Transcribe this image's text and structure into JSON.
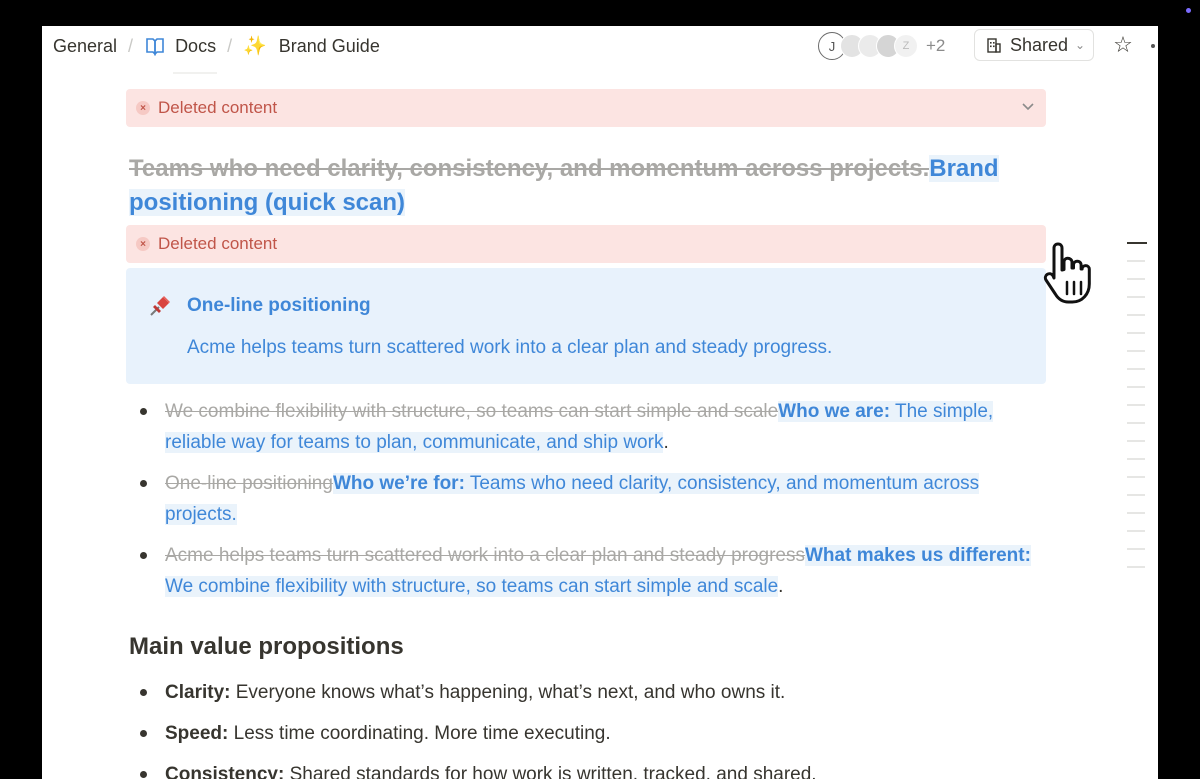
{
  "breadcrumb": {
    "items": [
      "General",
      "Docs",
      "Brand Guide"
    ],
    "separator": "/",
    "icons": [
      "",
      "book-icon",
      "sparkle-icon"
    ]
  },
  "collaborators": {
    "initials": [
      "J",
      "",
      "",
      "",
      "Z"
    ],
    "more_count": "+2"
  },
  "share_button": {
    "label": "Shared"
  },
  "deleted_banners": [
    {
      "label": "Deleted content"
    },
    {
      "label": "Deleted content"
    }
  ],
  "heading": {
    "deleted_text": "Teams who need clarity, consistency, and momentum across projects.",
    "added_text": "Brand positioning (quick scan)"
  },
  "callout": {
    "icon": "pushpin",
    "title": "One-line positioning",
    "body": "Acme helps teams turn scattered work into a clear plan and steady progress."
  },
  "positioning_list": [
    {
      "deleted": "We combine flexibility with structure, so teams can start simple and scale",
      "added_bold": "Who we are:",
      "added_text": " The simple, reliable way for teams to plan, communicate, and ship work",
      "tail": "."
    },
    {
      "deleted": "One-line positioning",
      "added_bold": "Who we’re for:",
      "added_text": " Teams who need clarity, consistency, and momentum across projects.",
      "tail": ""
    },
    {
      "deleted": "Acme helps teams turn scattered work into a clear plan and steady progress",
      "added_bold": "What makes us different:",
      "added_text": " We combine flexibility with structure, so teams can start simple and scale",
      "tail": "."
    }
  ],
  "section_heading": "Main value propositions",
  "value_props": [
    {
      "term": "Clarity:",
      "text": " Everyone knows what’s happening, what’s next, and who owns it."
    },
    {
      "term": "Speed:",
      "text": " Less time coordinating. More time executing."
    },
    {
      "term": "Consistency:",
      "text": " Shared standards for how work is written, tracked, and shared."
    }
  ],
  "colors": {
    "accent_blue": "#3f87d8",
    "deleted_bg": "#fce4e2",
    "deleted_text": "#c05549",
    "callout_bg": "#e8f2fc"
  }
}
